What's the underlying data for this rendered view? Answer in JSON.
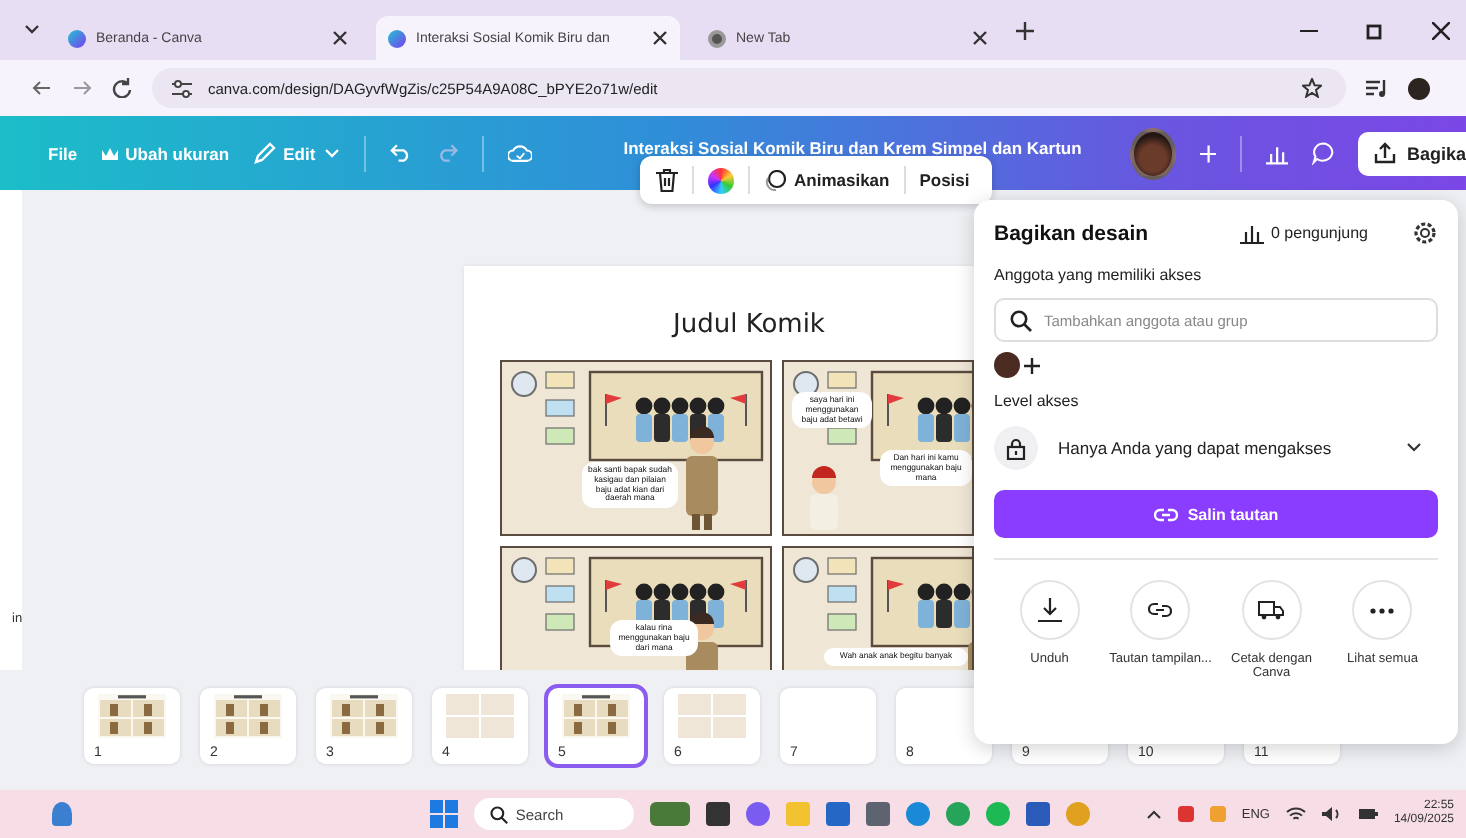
{
  "browser": {
    "tabs": [
      {
        "title": "Beranda - Canva",
        "selected": false,
        "kind": "canva"
      },
      {
        "title": "Interaksi Sosial Komik Biru dan",
        "selected": true,
        "kind": "canva"
      },
      {
        "title": "New Tab",
        "selected": false,
        "kind": "chrome"
      }
    ],
    "url": "canva.com/design/DAGyvfWgZis/c25P54A9A08C_bPYE2o71w/edit"
  },
  "toolbar": {
    "menu": [
      {
        "label": "File",
        "kind": "plain"
      },
      {
        "label": "Ubah ukuran",
        "kind": "crown"
      },
      {
        "label": "Edit",
        "kind": "pencil"
      }
    ],
    "title": "Interaksi Sosial Komik Biru dan Krem Simpel dan Kartun",
    "share_label": "Bagika"
  },
  "floating_toolbar": {
    "items": [
      "Animasikan",
      "Posisi"
    ]
  },
  "side_fragment": "in",
  "page": {
    "title": "Judul Komik",
    "panels": [
      {
        "kind": "teacher",
        "bubbles": [
          "bak santi bapak sudah kasigau dan pilaian baju adat kian dari daerah mana"
        ]
      },
      {
        "kind": "student",
        "bubbles": [
          "saya hari ini menggunakan baju adat betawi",
          "Dan hari ini kamu menggunakan baju mana"
        ]
      },
      {
        "kind": "teacher",
        "bubbles": [
          "kalau rina menggunakan baju dari mana"
        ]
      },
      {
        "kind": "teacher",
        "bubbles": [
          "Wah anak anak begitu banyak"
        ]
      }
    ]
  },
  "share": {
    "title": "Bagikan desain",
    "visitors": "0 pengunjung",
    "members_label": "Anggota yang memiliki akses",
    "search": {
      "placeholder": "Tambahkan anggota atau grup"
    },
    "level_label": "Level akses",
    "access": "Hanya Anda yang dapat mengakses",
    "copy_button": "Salin tautan",
    "actions": [
      {
        "label": "Unduh",
        "kind": "download"
      },
      {
        "label": "Tautan tampilan...",
        "kind": "link"
      },
      {
        "label": "Cetak dengan Canva",
        "kind": "truck"
      },
      {
        "label": "Lihat semua",
        "kind": "more"
      }
    ]
  },
  "thumbnails": [
    {
      "number": "1",
      "kind": "comic",
      "selected": false
    },
    {
      "number": "2",
      "kind": "comic",
      "selected": false
    },
    {
      "number": "3",
      "kind": "comic",
      "selected": false
    },
    {
      "number": "4",
      "kind": "grid",
      "selected": false
    },
    {
      "number": "5",
      "kind": "comic",
      "selected": true
    },
    {
      "number": "6",
      "kind": "grid",
      "selected": false
    },
    {
      "number": "7",
      "kind": "blank",
      "selected": false
    },
    {
      "number": "8",
      "kind": "blank",
      "selected": false
    },
    {
      "number": "9",
      "kind": "blank",
      "selected": false
    },
    {
      "number": "10",
      "kind": "blank",
      "selected": false
    },
    {
      "number": "11",
      "kind": "blank",
      "selected": false
    }
  ],
  "taskbar": {
    "search": {
      "placeholder": "Search"
    },
    "language": "ENG",
    "time": "22:55",
    "date": "14/09/2025"
  }
}
